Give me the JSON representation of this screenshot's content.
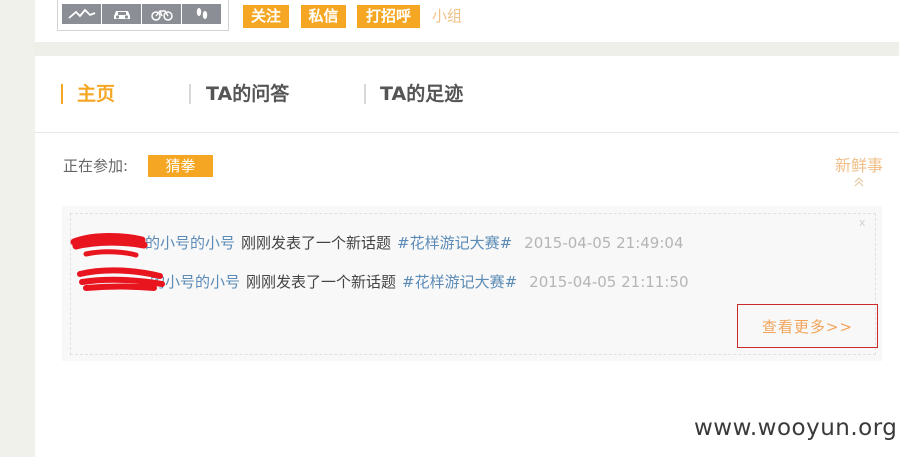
{
  "profile_icons": [
    {
      "icon": "mountain-icon"
    },
    {
      "icon": "car-icon"
    },
    {
      "icon": "bicycle-icon"
    },
    {
      "icon": "footprints-icon"
    }
  ],
  "actions": {
    "follow_label": "关注",
    "message_label": "私信",
    "greet_label": "打招呼",
    "group_label": "小组"
  },
  "tabs": [
    {
      "label": "主页",
      "active": true
    },
    {
      "label": "TA的问答",
      "active": false
    },
    {
      "label": "TA的足迹",
      "active": false
    }
  ],
  "joining": {
    "label": "正在参加:",
    "tag": "猜拳"
  },
  "fresh": {
    "label": "新鲜事"
  },
  "feed": {
    "items": [
      {
        "user": "的小号的小号",
        "action": "刚刚发表了一个新话题",
        "topic": "#花样游记大赛#",
        "time": "2015-04-05 21:49:04"
      },
      {
        "user": "的小号的小号",
        "action": "刚刚发表了一个新话题",
        "topic": "#花样游记大赛#",
        "time": "2015-04-05 21:11:50"
      }
    ],
    "close_mark": "x",
    "more_label": "查看更多>>"
  },
  "watermark": "www.wooyun.org",
  "colors": {
    "accent": "#f5a623",
    "link": "#5b8bb6",
    "highlight_box": "#c92b2b",
    "redaction": "#e8141e"
  }
}
